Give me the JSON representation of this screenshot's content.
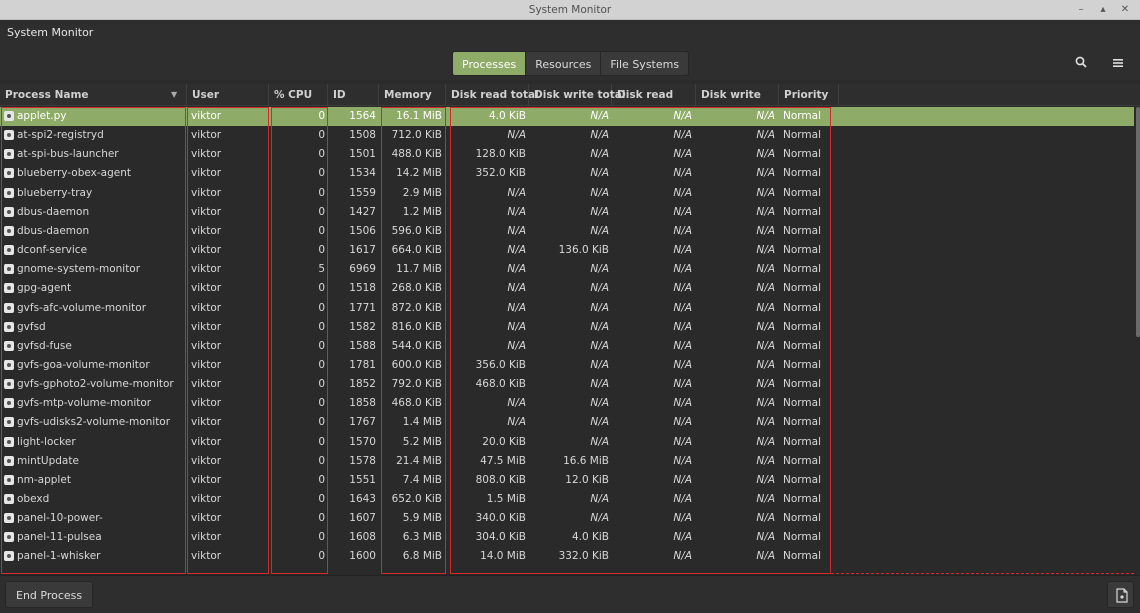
{
  "window": {
    "title": "System Monitor"
  },
  "header": {
    "app_title": "System Monitor",
    "tabs": [
      {
        "label": "Processes",
        "active": true
      },
      {
        "label": "Resources"
      },
      {
        "label": "File Systems"
      }
    ],
    "search_icon": "search-icon",
    "menu_icon": "hamburger-menu-icon"
  },
  "table": {
    "columns": [
      "Process Name",
      "User",
      "% CPU",
      "ID",
      "Memory",
      "Disk read total",
      "Disk write total",
      "Disk read",
      "Disk write",
      "Priority"
    ],
    "rows": [
      [
        "applet.py",
        "viktor",
        "0",
        "1564",
        "16.1 MiB",
        "4.0 KiB",
        "N/A",
        "N/A",
        "N/A",
        "Normal"
      ],
      [
        "at-spi2-registryd",
        "viktor",
        "0",
        "1508",
        "712.0 KiB",
        "N/A",
        "N/A",
        "N/A",
        "N/A",
        "Normal"
      ],
      [
        "at-spi-bus-launcher",
        "viktor",
        "0",
        "1501",
        "488.0 KiB",
        "128.0 KiB",
        "N/A",
        "N/A",
        "N/A",
        "Normal"
      ],
      [
        "blueberry-obex-agent",
        "viktor",
        "0",
        "1534",
        "14.2 MiB",
        "352.0 KiB",
        "N/A",
        "N/A",
        "N/A",
        "Normal"
      ],
      [
        "blueberry-tray",
        "viktor",
        "0",
        "1559",
        "2.9 MiB",
        "N/A",
        "N/A",
        "N/A",
        "N/A",
        "Normal"
      ],
      [
        "dbus-daemon",
        "viktor",
        "0",
        "1427",
        "1.2 MiB",
        "N/A",
        "N/A",
        "N/A",
        "N/A",
        "Normal"
      ],
      [
        "dbus-daemon",
        "viktor",
        "0",
        "1506",
        "596.0 KiB",
        "N/A",
        "N/A",
        "N/A",
        "N/A",
        "Normal"
      ],
      [
        "dconf-service",
        "viktor",
        "0",
        "1617",
        "664.0 KiB",
        "N/A",
        "136.0 KiB",
        "N/A",
        "N/A",
        "Normal"
      ],
      [
        "gnome-system-monitor",
        "viktor",
        "5",
        "6969",
        "11.7 MiB",
        "N/A",
        "N/A",
        "N/A",
        "N/A",
        "Normal"
      ],
      [
        "gpg-agent",
        "viktor",
        "0",
        "1518",
        "268.0 KiB",
        "N/A",
        "N/A",
        "N/A",
        "N/A",
        "Normal"
      ],
      [
        "gvfs-afc-volume-monitor",
        "viktor",
        "0",
        "1771",
        "872.0 KiB",
        "N/A",
        "N/A",
        "N/A",
        "N/A",
        "Normal"
      ],
      [
        "gvfsd",
        "viktor",
        "0",
        "1582",
        "816.0 KiB",
        "N/A",
        "N/A",
        "N/A",
        "N/A",
        "Normal"
      ],
      [
        "gvfsd-fuse",
        "viktor",
        "0",
        "1588",
        "544.0 KiB",
        "N/A",
        "N/A",
        "N/A",
        "N/A",
        "Normal"
      ],
      [
        "gvfs-goa-volume-monitor",
        "viktor",
        "0",
        "1781",
        "600.0 KiB",
        "356.0 KiB",
        "N/A",
        "N/A",
        "N/A",
        "Normal"
      ],
      [
        "gvfs-gphoto2-volume-monitor",
        "viktor",
        "0",
        "1852",
        "792.0 KiB",
        "468.0 KiB",
        "N/A",
        "N/A",
        "N/A",
        "Normal"
      ],
      [
        "gvfs-mtp-volume-monitor",
        "viktor",
        "0",
        "1858",
        "468.0 KiB",
        "N/A",
        "N/A",
        "N/A",
        "N/A",
        "Normal"
      ],
      [
        "gvfs-udisks2-volume-monitor",
        "viktor",
        "0",
        "1767",
        "1.4 MiB",
        "N/A",
        "N/A",
        "N/A",
        "N/A",
        "Normal"
      ],
      [
        "light-locker",
        "viktor",
        "0",
        "1570",
        "5.2 MiB",
        "20.0 KiB",
        "N/A",
        "N/A",
        "N/A",
        "Normal"
      ],
      [
        "mintUpdate",
        "viktor",
        "0",
        "1578",
        "21.4 MiB",
        "47.5 MiB",
        "16.6 MiB",
        "N/A",
        "N/A",
        "Normal"
      ],
      [
        "nm-applet",
        "viktor",
        "0",
        "1551",
        "7.4 MiB",
        "808.0 KiB",
        "12.0 KiB",
        "N/A",
        "N/A",
        "Normal"
      ],
      [
        "obexd",
        "viktor",
        "0",
        "1643",
        "652.0 KiB",
        "1.5 MiB",
        "N/A",
        "N/A",
        "N/A",
        "Normal"
      ],
      [
        "panel-10-power-",
        "viktor",
        "0",
        "1607",
        "5.9 MiB",
        "340.0 KiB",
        "N/A",
        "N/A",
        "N/A",
        "Normal"
      ],
      [
        "panel-11-pulsea",
        "viktor",
        "0",
        "1608",
        "6.3 MiB",
        "304.0 KiB",
        "4.0 KiB",
        "N/A",
        "N/A",
        "Normal"
      ],
      [
        "panel-1-whisker",
        "viktor",
        "0",
        "1600",
        "6.8 MiB",
        "14.0 MiB",
        "332.0 KiB",
        "N/A",
        "N/A",
        "Normal"
      ]
    ]
  },
  "footer": {
    "end_process_label": "End Process",
    "properties_icon": "document-properties-icon"
  },
  "colors": {
    "accent": "#8fab68",
    "highlight_border": "#d22a2a"
  }
}
